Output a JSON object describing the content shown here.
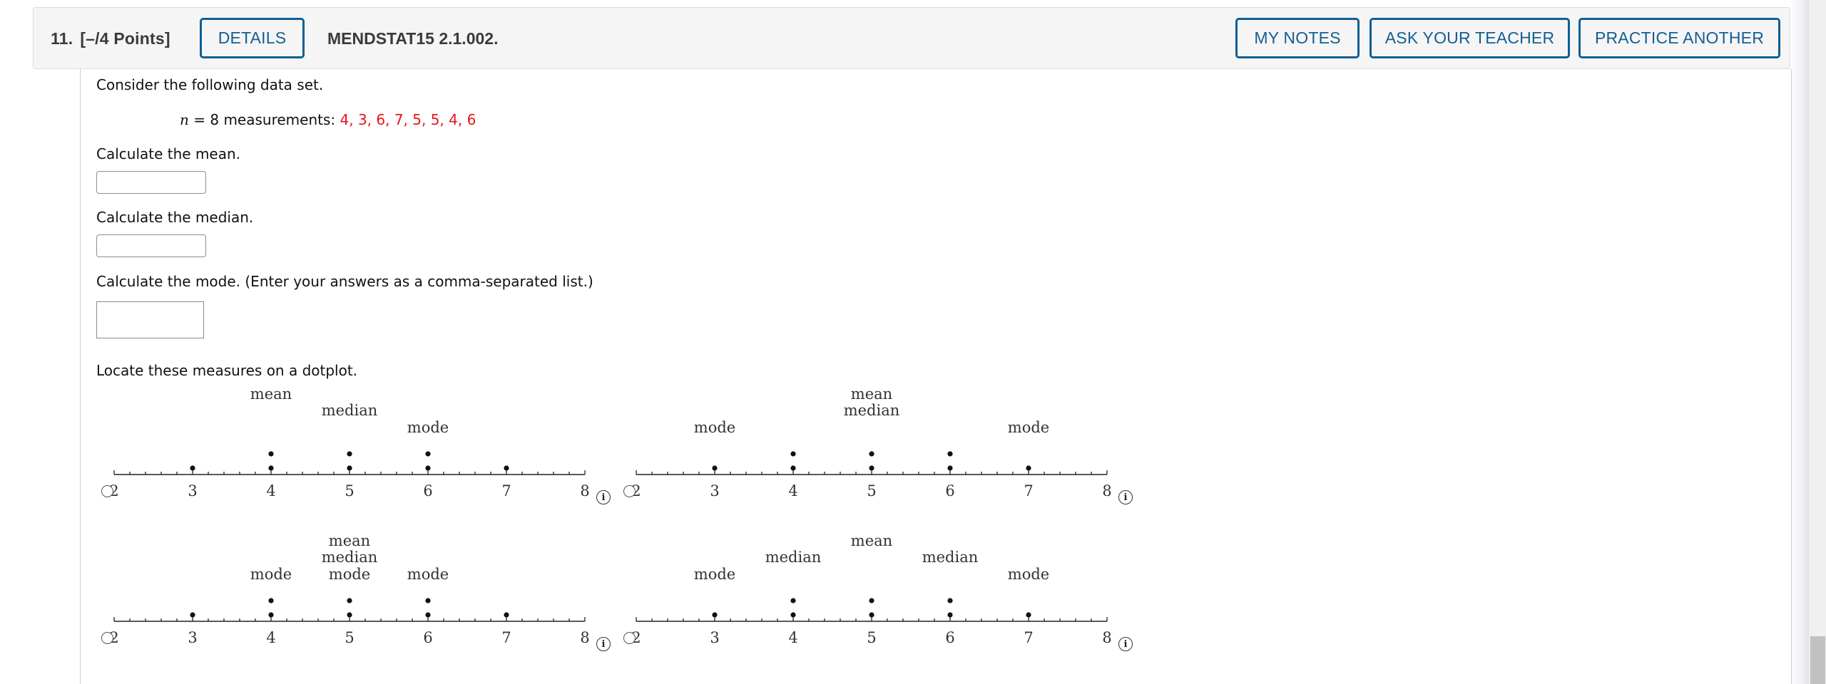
{
  "question": {
    "number": "11.",
    "points": "[–/4 Points]",
    "details_label": "DETAILS",
    "id": "MENDSTAT15 2.1.002.",
    "my_notes_label": "MY NOTES",
    "ask_teacher_label": "ASK YOUR TEACHER",
    "practice_another_label": "PRACTICE ANOTHER"
  },
  "body": {
    "intro": "Consider the following data set.",
    "n_var": "n",
    "n_text": " = 8 measurements: ",
    "measurements": "4, 3, 6, 7, 5, 5, 4, 6",
    "mean_prompt": "Calculate the mean.",
    "mean_value": "",
    "median_prompt": "Calculate the median.",
    "median_value": "",
    "mode_prompt": "Calculate the mode. (Enter your answers as a comma-separated list.)",
    "mode_value": "",
    "dotplot_prompt": "Locate these measures on a dotplot."
  },
  "colors": {
    "accent": "#0e5f93",
    "measurements": "#e8141a"
  },
  "chart_data": [
    {
      "type": "scatter",
      "name": "option-1",
      "xlim": [
        2,
        8
      ],
      "major_ticks": [
        2,
        3,
        4,
        5,
        6,
        7,
        8
      ],
      "minor_tick_step": 0.2,
      "tick_labels": [
        "2",
        "3",
        "4",
        "5",
        "6",
        "7",
        "8"
      ],
      "dots": [
        3,
        4,
        4,
        5,
        5,
        6,
        6,
        7
      ],
      "annotations": [
        {
          "text": "mean",
          "x": 4,
          "row": 3
        },
        {
          "text": "median",
          "x": 5,
          "row": 2
        },
        {
          "text": "mode",
          "x": 6,
          "row": 1
        }
      ],
      "selected": false
    },
    {
      "type": "scatter",
      "name": "option-2",
      "xlim": [
        2,
        8
      ],
      "major_ticks": [
        2,
        3,
        4,
        5,
        6,
        7,
        8
      ],
      "minor_tick_step": 0.2,
      "tick_labels": [
        "2",
        "3",
        "4",
        "5",
        "6",
        "7",
        "8"
      ],
      "dots": [
        3,
        4,
        4,
        5,
        5,
        6,
        6,
        7
      ],
      "annotations": [
        {
          "text": "mode",
          "x": 3,
          "row": 1
        },
        {
          "text": "mean",
          "x": 5,
          "row": 3
        },
        {
          "text": "median",
          "x": 5,
          "row": 2
        },
        {
          "text": "mode",
          "x": 7,
          "row": 1
        }
      ],
      "selected": false
    },
    {
      "type": "scatter",
      "name": "option-3",
      "xlim": [
        2,
        8
      ],
      "major_ticks": [
        2,
        3,
        4,
        5,
        6,
        7,
        8
      ],
      "minor_tick_step": 0.2,
      "tick_labels": [
        "2",
        "3",
        "4",
        "5",
        "6",
        "7",
        "8"
      ],
      "dots": [
        3,
        4,
        4,
        5,
        5,
        6,
        6,
        7
      ],
      "annotations": [
        {
          "text": "mode",
          "x": 4,
          "row": 1
        },
        {
          "text": "mean",
          "x": 5,
          "row": 3
        },
        {
          "text": "median",
          "x": 5,
          "row": 2
        },
        {
          "text": "mode",
          "x": 5,
          "row": 1
        },
        {
          "text": "mode",
          "x": 6,
          "row": 1
        }
      ],
      "selected": false
    },
    {
      "type": "scatter",
      "name": "option-4",
      "xlim": [
        2,
        8
      ],
      "major_ticks": [
        2,
        3,
        4,
        5,
        6,
        7,
        8
      ],
      "minor_tick_step": 0.2,
      "tick_labels": [
        "2",
        "3",
        "4",
        "5",
        "6",
        "7",
        "8"
      ],
      "dots": [
        3,
        4,
        4,
        5,
        5,
        6,
        6,
        7
      ],
      "annotations": [
        {
          "text": "mode",
          "x": 3,
          "row": 1
        },
        {
          "text": "median",
          "x": 4,
          "row": 2
        },
        {
          "text": "mean",
          "x": 5,
          "row": 3
        },
        {
          "text": "median",
          "x": 6,
          "row": 2
        },
        {
          "text": "mode",
          "x": 7,
          "row": 1
        }
      ],
      "selected": false
    }
  ]
}
